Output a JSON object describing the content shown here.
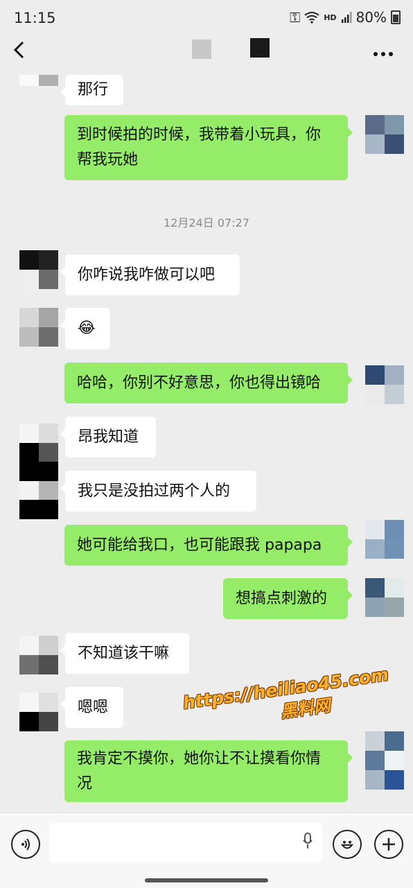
{
  "status_bar": {
    "time": "11:15",
    "network": "HD",
    "battery": "80%"
  },
  "nav": {
    "back_icon": "chevron-left-icon",
    "more_icon": "more-dots-icon"
  },
  "chat": {
    "timestamp": "12月24日 07:27",
    "messages": [
      {
        "side": "in",
        "text": "那行"
      },
      {
        "side": "out",
        "text": "到时候拍的时候，我带着小玩具，你帮我玩她"
      },
      {
        "side": "in",
        "text": "你咋说我咋做可以吧"
      },
      {
        "side": "in",
        "text": "😂"
      },
      {
        "side": "out",
        "text": "哈哈，你别不好意思，你也得出镜哈"
      },
      {
        "side": "in",
        "text": "昂我知道"
      },
      {
        "side": "in",
        "text": "我只是没拍过两个人的"
      },
      {
        "side": "out",
        "text": "她可能给我口，也可能跟我 papapa"
      },
      {
        "side": "out",
        "text": "想搞点刺激的"
      },
      {
        "side": "in",
        "text": "不知道该干嘛"
      },
      {
        "side": "in",
        "text": "嗯嗯"
      },
      {
        "side": "out",
        "text": "我肯定不摸你，她你让不让摸看你情况"
      }
    ]
  },
  "watermark": {
    "url": "https://heiliao45.com",
    "name": "黑料网"
  },
  "input_bar": {
    "voice_icon": "voice-icon",
    "mic_icon": "mic-icon",
    "emoji_icon": "emoji-icon",
    "plus_icon": "plus-icon"
  },
  "colors": {
    "background": "#ededed",
    "outgoing_bubble": "#95ec69",
    "incoming_bubble": "#ffffff"
  }
}
